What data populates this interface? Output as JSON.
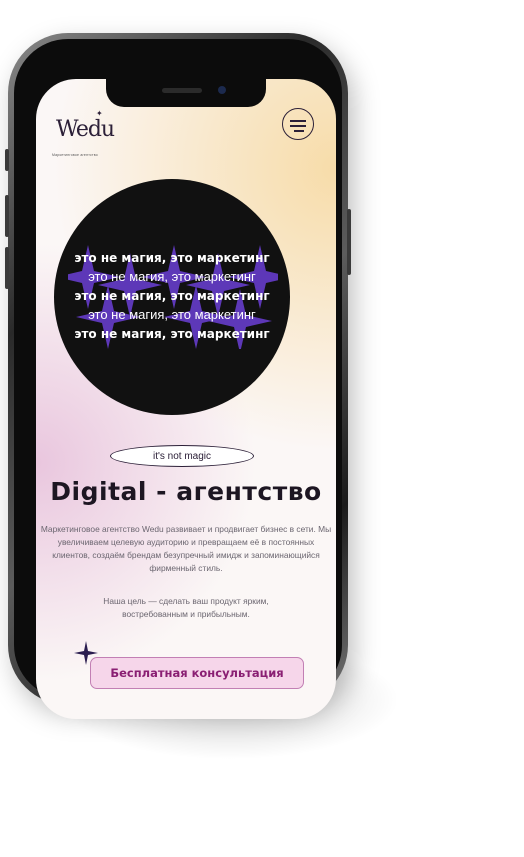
{
  "brand": {
    "logo": "Wedu",
    "tagline": "Маркетинговое агентство"
  },
  "menu_icon": "hamburger-menu-icon",
  "hero": {
    "marquee_lines": [
      "это не магия, это маркетинг",
      "это не магия, это маркетинг",
      "это не магия, это маркетинг",
      "это не магия, это маркетинг",
      "это не магия, это маркетинг"
    ],
    "pill": "it's not magic",
    "title": "Digital - агентство",
    "description": "Маркетинговое агентство Wedu развивает и продвигает бизнес в сети. Мы увеличиваем целевую аудиторию и превращаем её в постоянных клиентов, создаём брендам безупречный имидж и запоминающийся фирменный стиль.",
    "goal": "Наша цель — сделать ваш продукт ярким, востребованным и прибыльным.",
    "cta": "Бесплатная консультация"
  },
  "colors": {
    "accent": "#8a1f73",
    "cta_bg": "#f6d6ea",
    "circle": "#111111",
    "star": "#6b3fd6"
  }
}
